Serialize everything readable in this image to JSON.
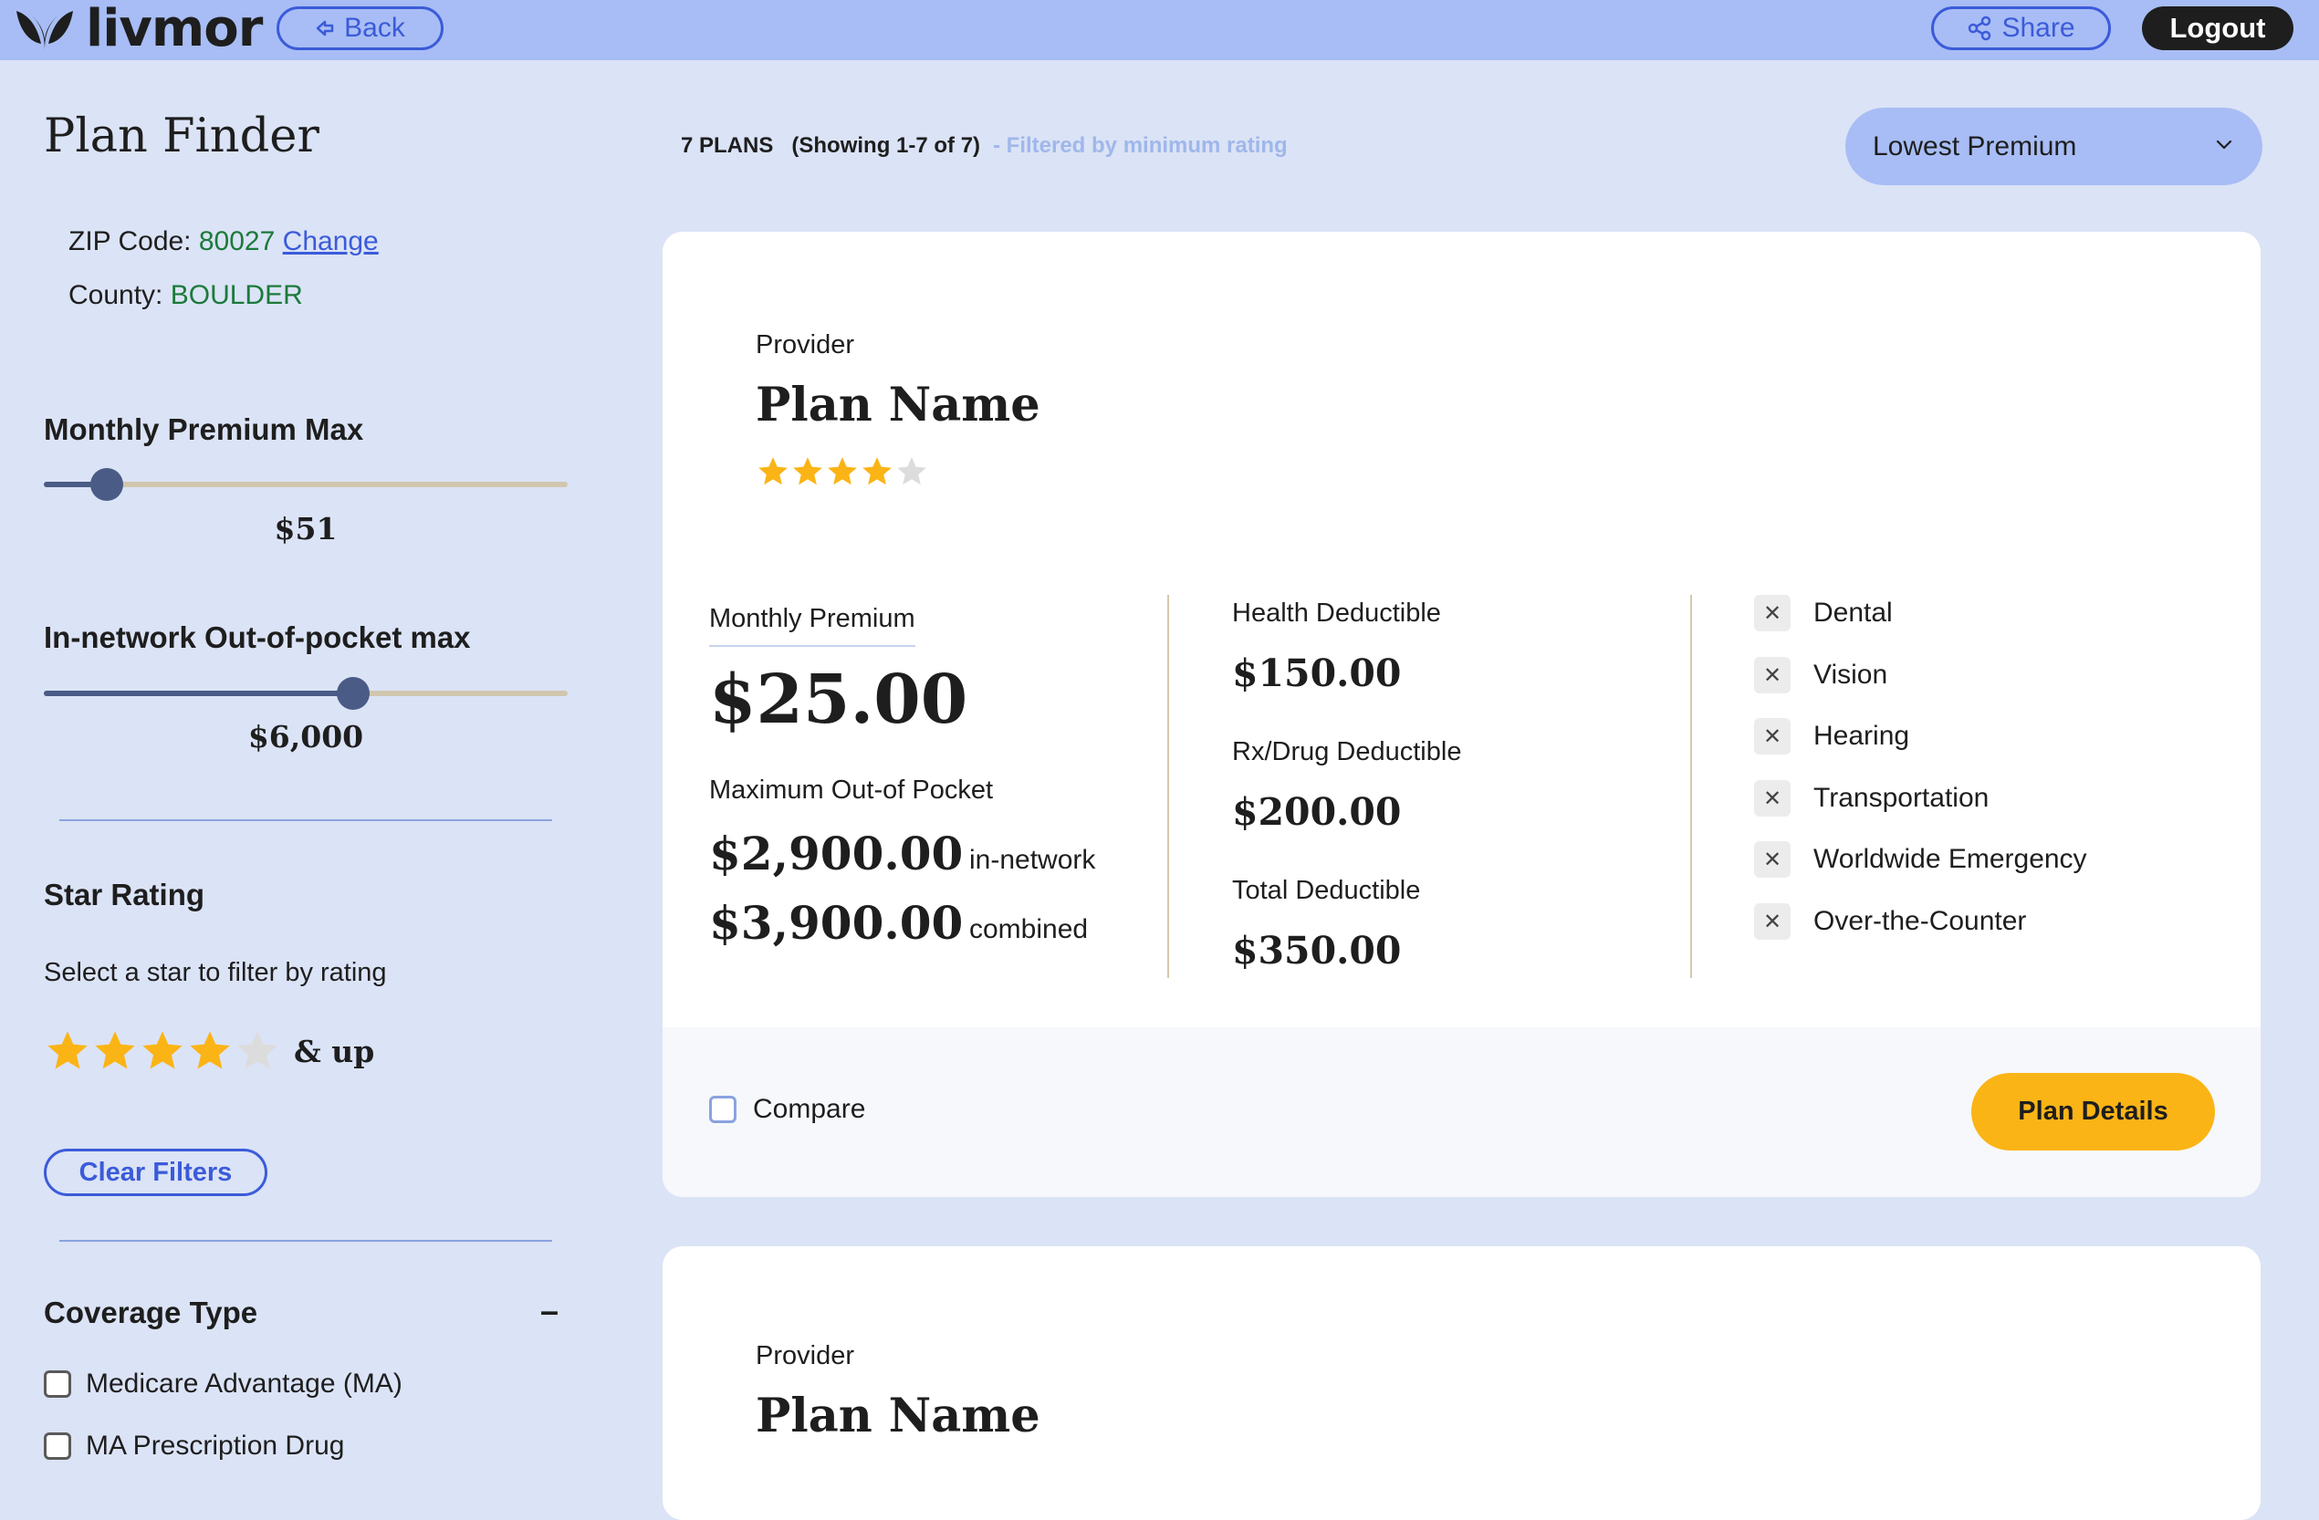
{
  "header": {
    "logo_text": "livmor",
    "back_label": "Back",
    "share_label": "Share",
    "logout_label": "Logout"
  },
  "sidebar": {
    "title": "Plan Finder",
    "zip_label": "ZIP Code:",
    "zip_value": "80027",
    "zip_change": "Change",
    "county_label": "County:",
    "county_value": "BOULDER",
    "premium_label": "Monthly Premium Max",
    "premium_value": "$51",
    "premium_fraction": 0.12,
    "oop_label": "In-network Out-of-pocket max",
    "oop_value": "$6,000",
    "oop_fraction": 0.59,
    "star_rating_label": "Star Rating",
    "star_rating_hint": "Select a star to filter by rating",
    "star_rating_selected": 4,
    "star_rating_suffix": "& up",
    "clear_filters": "Clear Filters",
    "coverage_label": "Coverage Type",
    "coverage_toggle": "–",
    "coverage_options": [
      "Medicare Advantage (MA)",
      "MA Prescription Drug"
    ]
  },
  "results": {
    "count": "7 PLANS",
    "showing": "(Showing 1-7 of 7)",
    "filter_note": "- Filtered by minimum rating",
    "sort_value": "Lowest Premium"
  },
  "plans": [
    {
      "provider": "Provider",
      "name": "Plan Name",
      "rating": 4,
      "premium_label": "Monthly Premium",
      "premium": "$25.00",
      "moop_label": "Maximum Out-of Pocket",
      "moop_in_network": "$2,900.00",
      "moop_in_network_tag": "in-network",
      "moop_combined": "$3,900.00",
      "moop_combined_tag": "combined",
      "health_deductible_label": "Health Deductible",
      "health_deductible": "$150.00",
      "rx_deductible_label": "Rx/Drug Deductible",
      "rx_deductible": "$200.00",
      "total_deductible_label": "Total Deductible",
      "total_deductible": "$350.00",
      "benefits": [
        "Dental",
        "Vision",
        "Hearing",
        "Transportation",
        "Worldwide Emergency",
        "Over-the-Counter"
      ],
      "compare_label": "Compare",
      "details_label": "Plan Details"
    },
    {
      "provider": "Provider",
      "name": "Plan Name"
    }
  ],
  "colors": {
    "topbar": "#a8bdf5",
    "background": "#dbe3f6",
    "accent_blue": "#3b5bd9",
    "star_gold": "#fbb415",
    "star_empty": "#dcdcdc",
    "button_yellow": "#fbb415"
  },
  "icons": {
    "logo": "leaf-logo-icon",
    "back": "back-arrow-icon",
    "share": "share-icon",
    "sort": "chevron-down-icon",
    "benefit_unavailable": "close-icon"
  }
}
